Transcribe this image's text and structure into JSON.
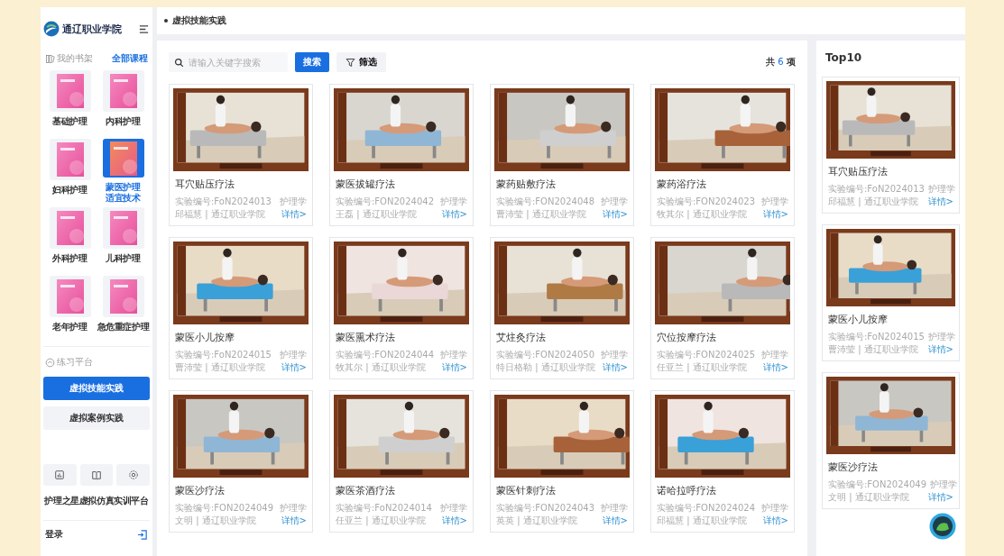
{
  "logo": {
    "text": "通辽职业学院"
  },
  "sidebar": {
    "shelf_title": "我的书架",
    "all_courses": "全部课程",
    "books": [
      {
        "label": "基础护理",
        "selected": false
      },
      {
        "label": "内科护理",
        "selected": false
      },
      {
        "label": "妇科护理",
        "selected": false
      },
      {
        "label": "蒙医护理适宜技术",
        "selected": true
      },
      {
        "label": "外科护理",
        "selected": false
      },
      {
        "label": "儿科护理",
        "selected": false
      },
      {
        "label": "老年护理",
        "selected": false
      },
      {
        "label": "急危重症护理",
        "selected": false
      }
    ],
    "practice_title": "练习平台",
    "practice_buttons": [
      {
        "label": "虚拟技能实践",
        "selected": true
      },
      {
        "label": "虚拟案例实践",
        "selected": false
      }
    ],
    "platform_name": "护理之星虚拟仿真实训平台",
    "login": "登录"
  },
  "breadcrumb": "虚拟技能实践",
  "toolbar": {
    "search": {
      "placeholder": "请输入关键字搜索"
    },
    "search_button": "搜索",
    "filter_button": "筛选",
    "total_prefix": "共",
    "total_count": "6",
    "total_suffix": "项"
  },
  "cards": [
    {
      "title": "耳穴贴压疗法",
      "code": "实验编号:FoN2024013",
      "subject": "护理学",
      "author": "邱福慧 | 通辽职业学院",
      "link": "详情>"
    },
    {
      "title": "蒙医拔罐疗法",
      "code": "实验编号:FON2024042",
      "subject": "护理学",
      "author": "王磊 | 通辽职业学院",
      "link": "详情>"
    },
    {
      "title": "蒙药贴敷疗法",
      "code": "实验编号:FON2024048",
      "subject": "护理学",
      "author": "曹沛莹 | 通辽职业学院",
      "link": "详情>"
    },
    {
      "title": "蒙药浴疗法",
      "code": "实验编号:FON2024023",
      "subject": "护理学",
      "author": "牧其尔 | 通辽职业学院",
      "link": "详情>"
    },
    {
      "title": "蒙医小儿按摩",
      "code": "实验编号:FoN2024015",
      "subject": "护理学",
      "author": "曹沛莹 | 通辽职业学院",
      "link": "详情>"
    },
    {
      "title": "蒙医熏术疗法",
      "code": "实验编号:FON2024044",
      "subject": "护理学",
      "author": "牧其尔 | 通辽职业学院",
      "link": "详情>"
    },
    {
      "title": "艾炷灸疗法",
      "code": "实验编号:FON2024050",
      "subject": "护理学",
      "author": "特日格勒 | 通辽职业学院",
      "link": "详情>"
    },
    {
      "title": "穴位按摩疗法",
      "code": "实验编号:FON2024025",
      "subject": "护理学",
      "author": "任亚兰 | 通辽职业学院",
      "link": "详情>"
    },
    {
      "title": "蒙医沙疗法",
      "code": "实验编号:FON2024049",
      "subject": "护理学",
      "author": "文明 | 通辽职业学院",
      "link": "详情>"
    },
    {
      "title": "蒙医茶酒疗法",
      "code": "实验编号:FoN2024014",
      "subject": "护理学",
      "author": "任亚兰 | 通辽职业学院",
      "link": "详情>"
    },
    {
      "title": "蒙医针刺疗法",
      "code": "实验编号:FON2024043",
      "subject": "护理学",
      "author": "英英 | 通辽职业学院",
      "link": "详情>"
    },
    {
      "title": "诺哈拉呼疗法",
      "code": "实验编号:FON2024024",
      "subject": "护理学",
      "author": "邱福慧 | 通辽职业学院",
      "link": "详情>"
    }
  ],
  "top10": {
    "title": "Top10",
    "cards": [
      {
        "title": "耳穴贴压疗法",
        "code": "实验编号:FoN2024013",
        "subject": "护理学",
        "author": "邱福慧 | 通辽职业学院",
        "link": "详情>"
      },
      {
        "title": "蒙医小儿按摩",
        "code": "实验编号:FoN2024015",
        "subject": "护理学",
        "author": "曹沛莹 | 通辽职业学院",
        "link": "详情>"
      },
      {
        "title": "蒙医沙疗法",
        "code": "实验编号:FON2024049",
        "subject": "护理学",
        "author": "文明 | 通辽职业学院",
        "link": "详情>"
      }
    ]
  }
}
